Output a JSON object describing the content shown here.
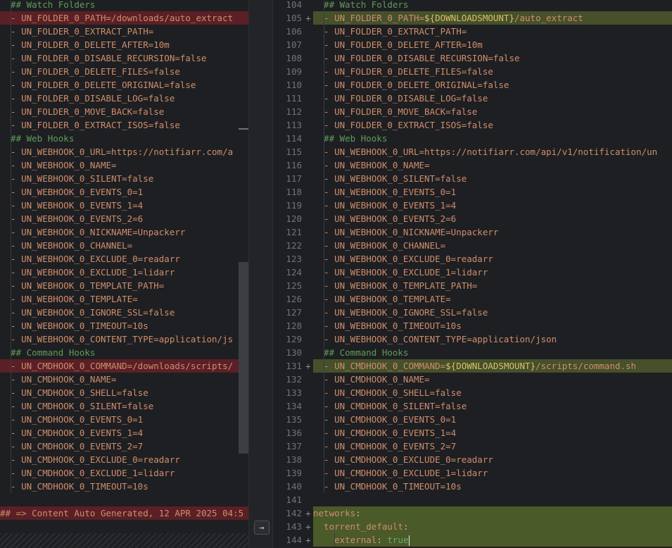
{
  "left": {
    "lines": [
      {
        "text": "  ## Watch Folders",
        "type": "comment"
      },
      {
        "text": "  - UN_FOLDER_0_PATH=/downloads/auto_extract",
        "type": "item",
        "state": "removed"
      },
      {
        "text": "  - UN_FOLDER_0_EXTRACT_PATH=",
        "type": "item"
      },
      {
        "text": "  - UN_FOLDER_0_DELETE_AFTER=10m",
        "type": "item"
      },
      {
        "text": "  - UN_FOLDER_0_DISABLE_RECURSION=false",
        "type": "item"
      },
      {
        "text": "  - UN_FOLDER_0_DELETE_FILES=false",
        "type": "item"
      },
      {
        "text": "  - UN_FOLDER_0_DELETE_ORIGINAL=false",
        "type": "item"
      },
      {
        "text": "  - UN_FOLDER_0_DISABLE_LOG=false",
        "type": "item"
      },
      {
        "text": "  - UN_FOLDER_0_MOVE_BACK=false",
        "type": "item"
      },
      {
        "text": "  - UN_FOLDER_0_EXTRACT_ISOS=false",
        "type": "item"
      },
      {
        "text": "  ## Web Hooks",
        "type": "comment"
      },
      {
        "text": "  - UN_WEBHOOK_0_URL=https://notifiarr.com/a",
        "type": "item"
      },
      {
        "text": "  - UN_WEBHOOK_0_NAME=",
        "type": "item"
      },
      {
        "text": "  - UN_WEBHOOK_0_SILENT=false",
        "type": "item"
      },
      {
        "text": "  - UN_WEBHOOK_0_EVENTS_0=1",
        "type": "item"
      },
      {
        "text": "  - UN_WEBHOOK_0_EVENTS_1=4",
        "type": "item"
      },
      {
        "text": "  - UN_WEBHOOK_0_EVENTS_2=6",
        "type": "item"
      },
      {
        "text": "  - UN_WEBHOOK_0_NICKNAME=Unpackerr",
        "type": "item"
      },
      {
        "text": "  - UN_WEBHOOK_0_CHANNEL=",
        "type": "item"
      },
      {
        "text": "  - UN_WEBHOOK_0_EXCLUDE_0=readarr",
        "type": "item"
      },
      {
        "text": "  - UN_WEBHOOK_0_EXCLUDE_1=lidarr",
        "type": "item"
      },
      {
        "text": "  - UN_WEBHOOK_0_TEMPLATE_PATH=",
        "type": "item"
      },
      {
        "text": "  - UN_WEBHOOK_0_TEMPLATE=",
        "type": "item"
      },
      {
        "text": "  - UN_WEBHOOK_0_IGNORE_SSL=false",
        "type": "item"
      },
      {
        "text": "  - UN_WEBHOOK_0_TIMEOUT=10s",
        "type": "item"
      },
      {
        "text": "  - UN_WEBHOOK_0_CONTENT_TYPE=application/js",
        "type": "item"
      },
      {
        "text": "  ## Command Hooks",
        "type": "comment"
      },
      {
        "text": "  - UN_CMDHOOK_0_COMMAND=/downloads/scripts/",
        "type": "item",
        "state": "removed"
      },
      {
        "text": "  - UN_CMDHOOK_0_NAME=",
        "type": "item"
      },
      {
        "text": "  - UN_CMDHOOK_0_SHELL=false",
        "type": "item"
      },
      {
        "text": "  - UN_CMDHOOK_0_SILENT=false",
        "type": "item"
      },
      {
        "text": "  - UN_CMDHOOK_0_EVENTS_0=1",
        "type": "item"
      },
      {
        "text": "  - UN_CMDHOOK_0_EVENTS_1=4",
        "type": "item"
      },
      {
        "text": "  - UN_CMDHOOK_0_EVENTS_2=7",
        "type": "item"
      },
      {
        "text": "  - UN_CMDHOOK_0_EXCLUDE_0=readarr",
        "type": "item"
      },
      {
        "text": "  - UN_CMDHOOK_0_EXCLUDE_1=lidarr",
        "type": "item"
      },
      {
        "text": "  - UN_CMDHOOK_0_TIMEOUT=10s",
        "type": "item"
      },
      {
        "text": "",
        "type": "blank"
      },
      {
        "text": "## => Content Auto Generated, 12 APR 2025 04:5",
        "type": "item",
        "state": "removed"
      }
    ]
  },
  "right": {
    "lines": [
      {
        "num": "104",
        "plus": "",
        "parts": [
          {
            "t": "  ## Watch Folders",
            "c": "comment"
          }
        ]
      },
      {
        "num": "105",
        "plus": "+",
        "state": "added",
        "parts": [
          {
            "t": "  - UN_FOLDER_0_PATH=",
            "c": "item"
          },
          {
            "t": "${DOWNLOADSMOUNT}",
            "c": "vlink"
          },
          {
            "t": "/auto_extract",
            "c": "item"
          }
        ]
      },
      {
        "num": "106",
        "plus": "",
        "parts": [
          {
            "t": "  - UN_FOLDER_0_EXTRACT_PATH=",
            "c": "item"
          }
        ]
      },
      {
        "num": "107",
        "plus": "",
        "parts": [
          {
            "t": "  - UN_FOLDER_0_DELETE_AFTER=10m",
            "c": "item"
          }
        ]
      },
      {
        "num": "108",
        "plus": "",
        "parts": [
          {
            "t": "  - UN_FOLDER_0_DISABLE_RECURSION=false",
            "c": "item"
          }
        ]
      },
      {
        "num": "109",
        "plus": "",
        "parts": [
          {
            "t": "  - UN_FOLDER_0_DELETE_FILES=false",
            "c": "item"
          }
        ]
      },
      {
        "num": "110",
        "plus": "",
        "parts": [
          {
            "t": "  - UN_FOLDER_0_DELETE_ORIGINAL=false",
            "c": "item"
          }
        ]
      },
      {
        "num": "111",
        "plus": "",
        "parts": [
          {
            "t": "  - UN_FOLDER_0_DISABLE_LOG=false",
            "c": "item"
          }
        ]
      },
      {
        "num": "112",
        "plus": "",
        "parts": [
          {
            "t": "  - UN_FOLDER_0_MOVE_BACK=false",
            "c": "item"
          }
        ]
      },
      {
        "num": "113",
        "plus": "",
        "parts": [
          {
            "t": "  - UN_FOLDER_0_EXTRACT_ISOS=false",
            "c": "item"
          }
        ]
      },
      {
        "num": "114",
        "plus": "",
        "parts": [
          {
            "t": "  ## Web Hooks",
            "c": "comment"
          }
        ]
      },
      {
        "num": "115",
        "plus": "",
        "parts": [
          {
            "t": "  - UN_WEBHOOK_0_URL=https://notifiarr.com/api/v1/notification/un",
            "c": "item"
          }
        ]
      },
      {
        "num": "116",
        "plus": "",
        "parts": [
          {
            "t": "  - UN_WEBHOOK_0_NAME=",
            "c": "item"
          }
        ]
      },
      {
        "num": "117",
        "plus": "",
        "parts": [
          {
            "t": "  - UN_WEBHOOK_0_SILENT=false",
            "c": "item"
          }
        ]
      },
      {
        "num": "118",
        "plus": "",
        "parts": [
          {
            "t": "  - UN_WEBHOOK_0_EVENTS_0=1",
            "c": "item"
          }
        ]
      },
      {
        "num": "119",
        "plus": "",
        "parts": [
          {
            "t": "  - UN_WEBHOOK_0_EVENTS_1=4",
            "c": "item"
          }
        ]
      },
      {
        "num": "120",
        "plus": "",
        "parts": [
          {
            "t": "  - UN_WEBHOOK_0_EVENTS_2=6",
            "c": "item"
          }
        ]
      },
      {
        "num": "121",
        "plus": "",
        "parts": [
          {
            "t": "  - UN_WEBHOOK_0_NICKNAME=Unpackerr",
            "c": "item"
          }
        ]
      },
      {
        "num": "122",
        "plus": "",
        "parts": [
          {
            "t": "  - UN_WEBHOOK_0_CHANNEL=",
            "c": "item"
          }
        ]
      },
      {
        "num": "123",
        "plus": "",
        "parts": [
          {
            "t": "  - UN_WEBHOOK_0_EXCLUDE_0=readarr",
            "c": "item"
          }
        ]
      },
      {
        "num": "124",
        "plus": "",
        "parts": [
          {
            "t": "  - UN_WEBHOOK_0_EXCLUDE_1=lidarr",
            "c": "item"
          }
        ]
      },
      {
        "num": "125",
        "plus": "",
        "parts": [
          {
            "t": "  - UN_WEBHOOK_0_TEMPLATE_PATH=",
            "c": "item"
          }
        ]
      },
      {
        "num": "126",
        "plus": "",
        "parts": [
          {
            "t": "  - UN_WEBHOOK_0_TEMPLATE=",
            "c": "item"
          }
        ]
      },
      {
        "num": "127",
        "plus": "",
        "parts": [
          {
            "t": "  - UN_WEBHOOK_0_IGNORE_SSL=false",
            "c": "item"
          }
        ]
      },
      {
        "num": "128",
        "plus": "",
        "parts": [
          {
            "t": "  - UN_WEBHOOK_0_TIMEOUT=10s",
            "c": "item"
          }
        ]
      },
      {
        "num": "129",
        "plus": "",
        "parts": [
          {
            "t": "  - UN_WEBHOOK_0_CONTENT_TYPE=application/json",
            "c": "item"
          }
        ]
      },
      {
        "num": "130",
        "plus": "",
        "parts": [
          {
            "t": "  ## Command Hooks",
            "c": "comment"
          }
        ]
      },
      {
        "num": "131",
        "plus": "+",
        "state": "added",
        "parts": [
          {
            "t": "  - UN_CMDHOOK_0_COMMAND=",
            "c": "item"
          },
          {
            "t": "${DOWNLOADSMOUNT}",
            "c": "vlink"
          },
          {
            "t": "/scripts/command.sh",
            "c": "item"
          }
        ]
      },
      {
        "num": "132",
        "plus": "",
        "parts": [
          {
            "t": "  - UN_CMDHOOK_0_NAME=",
            "c": "item"
          }
        ]
      },
      {
        "num": "133",
        "plus": "",
        "parts": [
          {
            "t": "  - UN_CMDHOOK_0_SHELL=false",
            "c": "item"
          }
        ]
      },
      {
        "num": "134",
        "plus": "",
        "parts": [
          {
            "t": "  - UN_CMDHOOK_0_SILENT=false",
            "c": "item"
          }
        ]
      },
      {
        "num": "135",
        "plus": "",
        "parts": [
          {
            "t": "  - UN_CMDHOOK_0_EVENTS_0=1",
            "c": "item"
          }
        ]
      },
      {
        "num": "136",
        "plus": "",
        "parts": [
          {
            "t": "  - UN_CMDHOOK_0_EVENTS_1=4",
            "c": "item"
          }
        ]
      },
      {
        "num": "137",
        "plus": "",
        "parts": [
          {
            "t": "  - UN_CMDHOOK_0_EVENTS_2=7",
            "c": "item"
          }
        ]
      },
      {
        "num": "138",
        "plus": "",
        "parts": [
          {
            "t": "  - UN_CMDHOOK_0_EXCLUDE_0=readarr",
            "c": "item"
          }
        ]
      },
      {
        "num": "139",
        "plus": "",
        "parts": [
          {
            "t": "  - UN_CMDHOOK_0_EXCLUDE_1=lidarr",
            "c": "item"
          }
        ]
      },
      {
        "num": "140",
        "plus": "",
        "parts": [
          {
            "t": "  - UN_CMDHOOK_0_TIMEOUT=10s",
            "c": "item"
          }
        ]
      },
      {
        "num": "141",
        "plus": "",
        "parts": []
      },
      {
        "num": "142",
        "plus": "+",
        "state": "added-strong",
        "parts": [
          {
            "t": "networks",
            "c": "key"
          },
          {
            "t": ":",
            "c": "plain"
          }
        ]
      },
      {
        "num": "143",
        "plus": "+",
        "state": "added-strong",
        "parts": [
          {
            "t": "  torrent_default",
            "c": "key"
          },
          {
            "t": ":",
            "c": "plain"
          }
        ]
      },
      {
        "num": "144",
        "plus": "+",
        "state": "added-strong",
        "caret": true,
        "parts": [
          {
            "t": "    external",
            "c": "key"
          },
          {
            "t": ": ",
            "c": "plain"
          },
          {
            "t": "true",
            "c": "kw"
          }
        ]
      }
    ]
  },
  "gap": {
    "arrow_icon": "→"
  }
}
